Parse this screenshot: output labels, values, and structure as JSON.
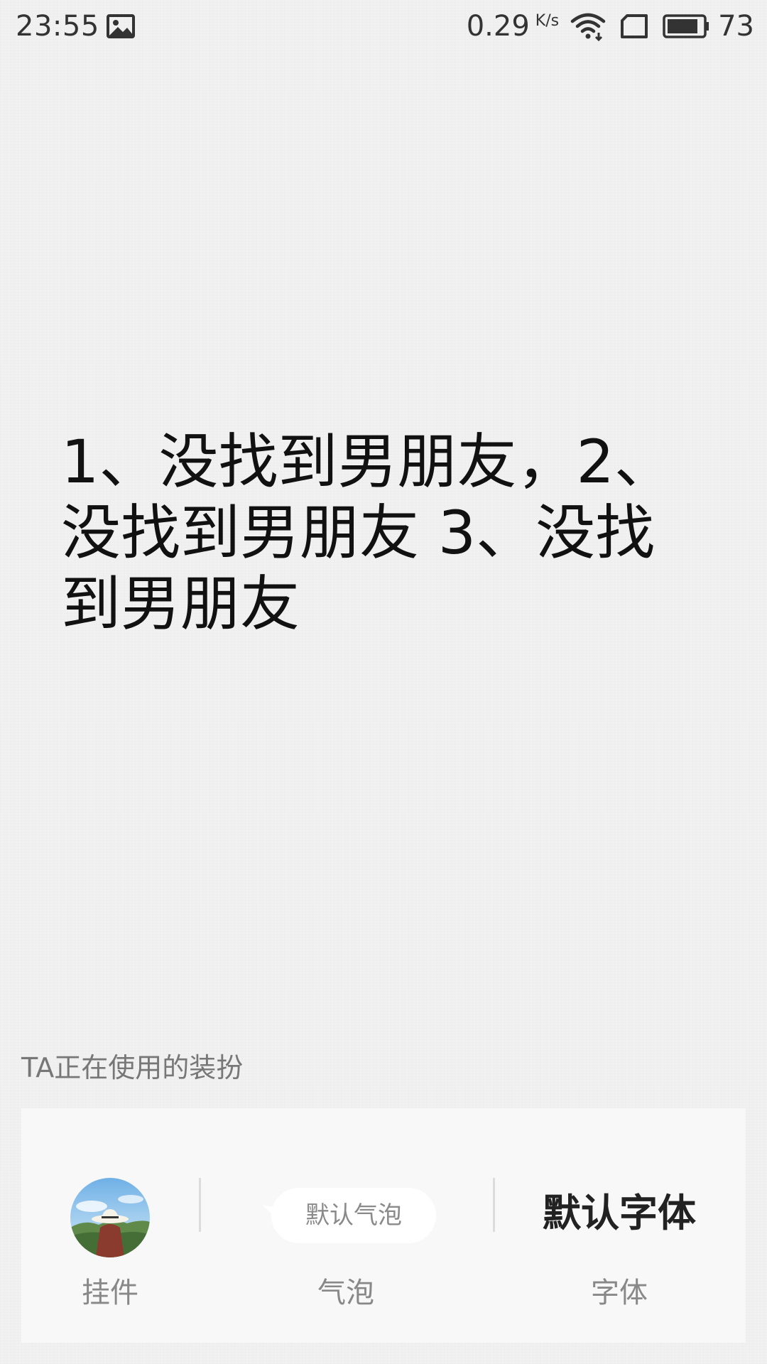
{
  "status_bar": {
    "time": "23:55",
    "gallery_icon": "image-icon",
    "speed_value": "0.29",
    "speed_unit": "K/s",
    "wifi_icon": "wifi-icon",
    "sim_icon": "sim-card-icon",
    "battery_icon": "battery-icon",
    "battery_level": "73"
  },
  "message": {
    "text": "1、没找到男朋友，2、没找到男朋友 3、没找到男朋友"
  },
  "decoration": {
    "section_label": "TA正在使用的装扮",
    "pendant": {
      "caption": "挂件",
      "icon": "avatar-image"
    },
    "bubble": {
      "sample_text": "默认气泡",
      "caption": "气泡"
    },
    "font": {
      "sample_text": "默认字体",
      "caption": "字体"
    }
  }
}
